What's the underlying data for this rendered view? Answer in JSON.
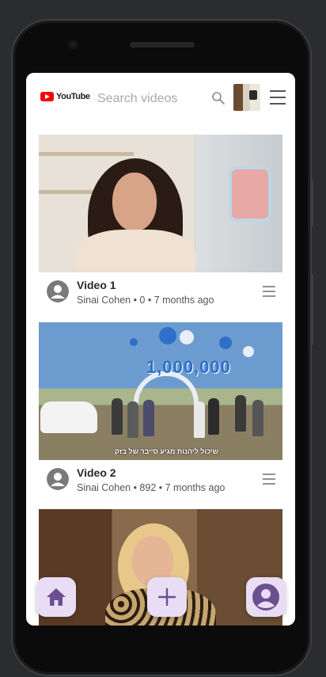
{
  "header": {
    "logo_text": "YouTube",
    "search_placeholder": "Search videos"
  },
  "videos": [
    {
      "title": "Video 1",
      "subtitle": "Sinai Cohen • 0 • 7 months ago"
    },
    {
      "title": "Video 2",
      "subtitle": "Sinai Cohen • 892 • 7 months ago",
      "thumb_caption": "שיכול ליהנות מגיע סייבר של בזק",
      "thumb_number": "1,000,000"
    },
    {
      "title": "",
      "subtitle": ""
    }
  ],
  "colors": {
    "brand_red": "#ff0000",
    "fab_bg": "#e9dcf5",
    "fab_icon": "#6b4f8f"
  },
  "icons": [
    "search-icon",
    "menu-icon",
    "user-avatar-icon",
    "home-icon",
    "plus-icon",
    "profile-icon"
  ]
}
